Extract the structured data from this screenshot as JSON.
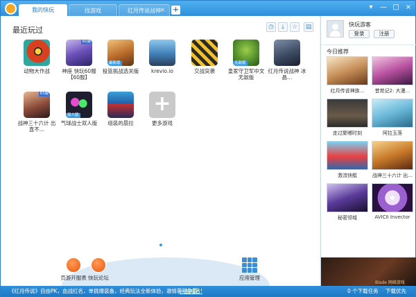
{
  "tabs": {
    "active_label": "我的快玩",
    "labels": [
      "我的快玩",
      "找游戏",
      "红月传说战神"
    ],
    "close": "×",
    "add": "+"
  },
  "window_controls": [
    "▾",
    "—",
    "□",
    "×"
  ],
  "main": {
    "section_title": "最近玩过",
    "toolbar_icons": [
      "clock-icon",
      "download-icon",
      "star-icon",
      "trash-icon"
    ],
    "games": [
      {
        "label": "动物大作战",
        "badge": "",
        "tag": ""
      },
      {
        "label": "神座 快玩60服【60服】",
        "badge": "",
        "tag": "60服"
      },
      {
        "label": "投篮挑战选关版",
        "badge": "最新版",
        "tag": ""
      },
      {
        "label": "krevio.io",
        "badge": "",
        "tag": ""
      },
      {
        "label": "交战突袭",
        "badge": "",
        "tag": ""
      },
      {
        "label": "皇家守卫军中文无敌版",
        "badge": "无敌版",
        "tag": ""
      },
      {
        "label": "红月传说战神 冰晶...",
        "badge": "",
        "tag": ""
      },
      {
        "label": "战神三十六计 出直不...",
        "badge": "",
        "tag": "63服"
      },
      {
        "label": "气球战士双人版",
        "badge": "双人版",
        "tag": ""
      },
      {
        "label": "组装的晨拉",
        "badge": "",
        "tag": ""
      },
      {
        "label": "更多游戏",
        "badge": "",
        "tag": ""
      }
    ],
    "more_symbol": "+"
  },
  "bottom": {
    "tools": [
      "页游开服表",
      "快玩论坛"
    ],
    "app_manage": "应用管理"
  },
  "sidebar": {
    "username": "快玩游客",
    "login": "登录",
    "register": "注册",
    "rec_title": "今日推荐",
    "recs": [
      "红月传说神族...",
      "昔苑记2: 大漫...",
      "走过聚嘟时刻",
      "阿拉玉落",
      "激流快艇",
      "战神三十六计 出...",
      "秘密领域",
      "AVICII Invector"
    ],
    "ad_text": "Blade 网络游戏"
  },
  "status": {
    "text": "《红月传说》自由PK，血战红名，单挑爆装备，经典玩法全新体验，邀情暑期争霸！",
    "link": "一战成名!",
    "downloads": "0 个下载任务",
    "speed": "下载优先"
  },
  "colors": {
    "accent": "#2f8fdc",
    "tab_text_active": "#2a7fc8",
    "orange": "#f5a623"
  }
}
